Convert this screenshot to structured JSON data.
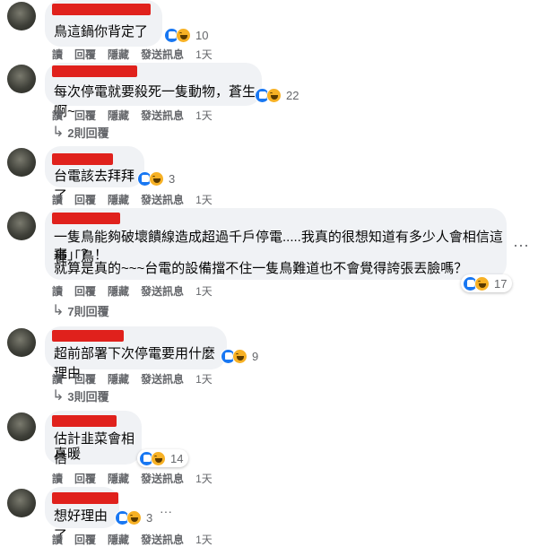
{
  "actions": {
    "read": "讀",
    "reply": "回覆",
    "hide": "隱藏",
    "message": "發送訊息"
  },
  "icons": {
    "like": "like-icon",
    "haha": "haha-icon",
    "reply_arrow": "reply-arrow-icon",
    "more": "more-options-icon"
  },
  "colors": {
    "like": "#1877f2",
    "haha": "#f7b125",
    "bubble": "#f0f2f5",
    "redaction": "#e0211c"
  },
  "comments": [
    {
      "text": "鳥這鍋你背定了",
      "reactions": "10",
      "time": "1天"
    },
    {
      "text": "每次停電就要殺死一隻動物，蒼生啊~",
      "reactions": "22",
      "time": "1天",
      "replies": "2則回覆"
    },
    {
      "text": "台電該去拜拜了",
      "reactions": "3",
      "time": "1天"
    },
    {
      "text_lines": [
        "一隻鳥能夠破壞饋線造成超過千戶停電.....我真的很想知道有多少人會相信這種「鳥",
        "事」？！",
        "就算是真的~~~台電的設備擋不住一隻鳥難道也不會覺得誇張丟臉嗎？"
      ],
      "reactions": "17",
      "time": "1天",
      "replies": "7則回覆"
    },
    {
      "text": "超前部署下次停電要用什麼理由",
      "reactions": "9",
      "time": "1天",
      "replies": "3則回覆"
    },
    {
      "text_lines": [
        "估計韭菜會相信",
        "真暖"
      ],
      "reactions": "14",
      "time": "1天"
    },
    {
      "text": "想好理由了",
      "reactions": "3",
      "time": "1天"
    }
  ]
}
